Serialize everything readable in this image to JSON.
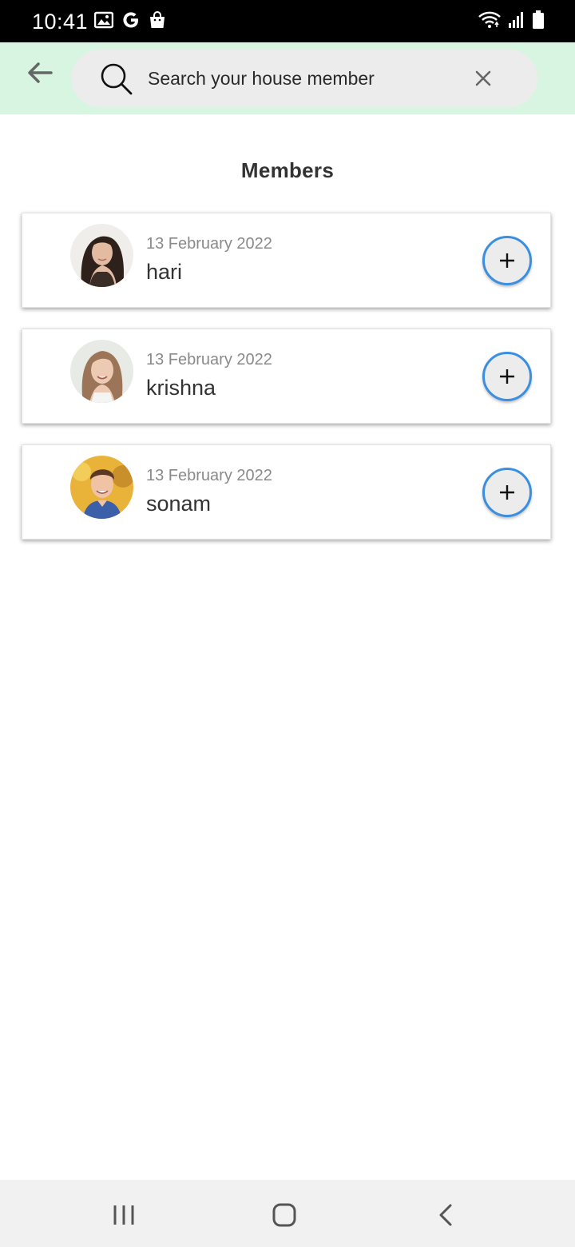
{
  "status_bar": {
    "time": "10:41",
    "left_icons": [
      "image-icon",
      "google-icon",
      "shopping-bag-icon"
    ],
    "right_icons": [
      "wifi-icon",
      "signal-icon",
      "battery-icon"
    ]
  },
  "header": {
    "back_icon": "arrow-left-icon",
    "search": {
      "placeholder": "Search your house member",
      "value": "",
      "search_icon": "search-icon",
      "clear_icon": "close-icon"
    }
  },
  "main": {
    "title": "Members",
    "members": [
      {
        "date": "13 February 2022",
        "name": "hari"
      },
      {
        "date": "13 February 2022",
        "name": "krishna"
      },
      {
        "date": "13 February 2022",
        "name": "sonam"
      }
    ]
  },
  "nav_bar": {
    "buttons": [
      "recents-icon",
      "home-icon",
      "back-icon"
    ]
  },
  "colors": {
    "header_bg": "#d8f5e2",
    "accent": "#3b8fe0",
    "search_bg": "#ececec"
  }
}
